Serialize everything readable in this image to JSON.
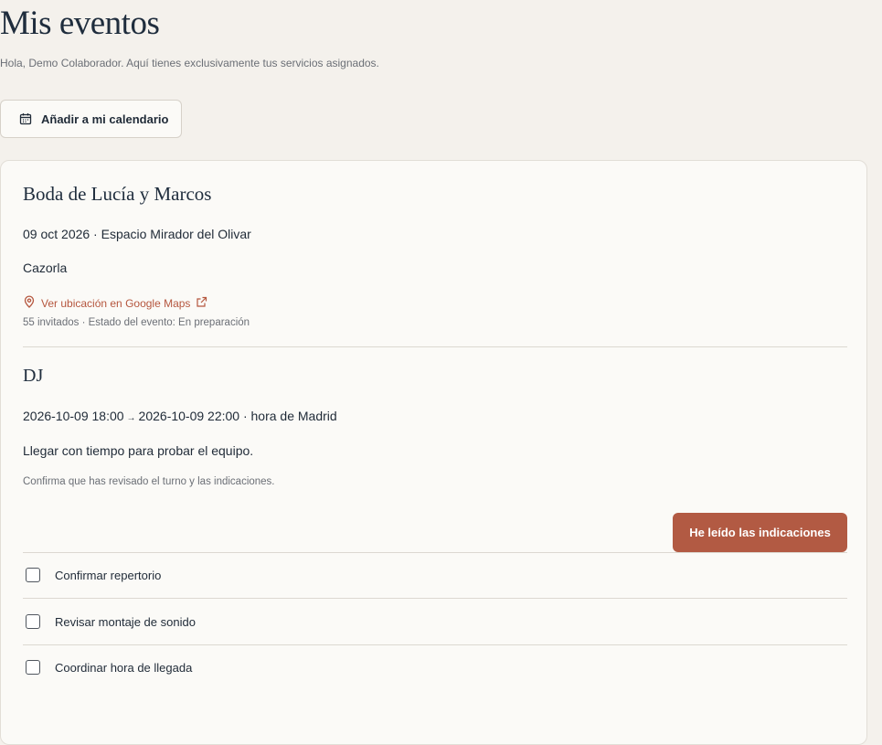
{
  "header": {
    "title": "Mis eventos",
    "subtitle": "Hola, Demo Colaborador. Aquí tienes exclusivamente tus servicios asignados.",
    "calendar_button_label": "Añadir a mi calendario"
  },
  "event": {
    "title": "Boda de Lucía y Marcos",
    "date_venue": "09 oct 2026 · Espacio Mirador del Olivar",
    "city": "Cazorla",
    "maps_link_label": "Ver ubicación en Google Maps",
    "meta": "55 invitados · Estado del evento: En preparación"
  },
  "service": {
    "title": "DJ",
    "start": "2026-10-09 18:00",
    "arrow": "→",
    "end_tz": "2026-10-09 22:00 · hora de Madrid",
    "note": "Llegar con tiempo para probar el equipo.",
    "confirm_hint": "Confirma que has revisado el turno y las indicaciones.",
    "read_button_label": "He leído las indicaciones",
    "tasks": [
      {
        "label": "Confirmar repertorio",
        "checked": false
      },
      {
        "label": "Revisar montaje de sonido",
        "checked": false
      },
      {
        "label": "Coordinar hora de llegada",
        "checked": false
      }
    ]
  },
  "colors": {
    "background": "#f4f1ec",
    "card": "#fbfaf7",
    "accent": "#b25a43",
    "link": "#b5563e",
    "text": "#1f2a37"
  },
  "icons": {
    "calendar": "calendar-icon",
    "location": "map-pin-icon",
    "external": "external-link-icon"
  }
}
